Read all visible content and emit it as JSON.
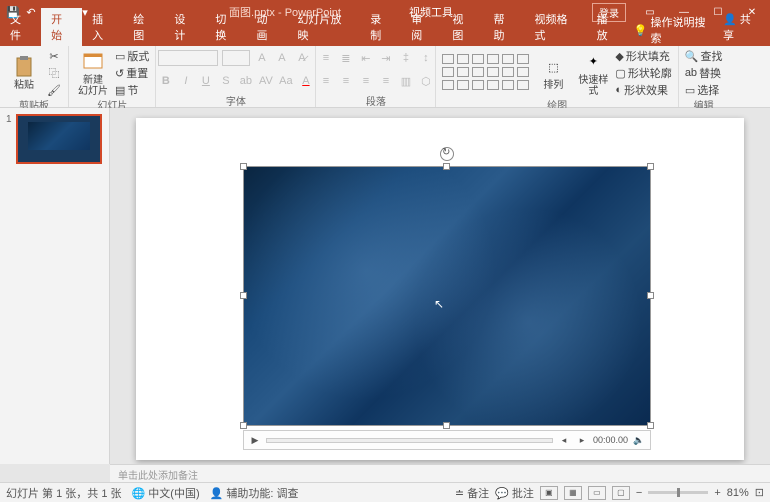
{
  "app": {
    "filename": "面图.pptx",
    "name": "PowerPoint",
    "context_tool": "视频工具"
  },
  "login": "登录",
  "tabs": {
    "items": [
      "文件",
      "开始",
      "插入",
      "绘图",
      "设计",
      "切换",
      "动画",
      "幻灯片放映",
      "录制",
      "审阅",
      "视图",
      "帮助",
      "视频格式",
      "播放"
    ],
    "active": "开始",
    "tellme": "操作说明搜索",
    "share": "共享"
  },
  "ribbon": {
    "clipboard": {
      "paste": "粘贴",
      "label": "剪贴板"
    },
    "slides": {
      "new": "新建\n幻灯片",
      "layout": "版式",
      "reset": "重置",
      "section": "节",
      "label": "幻灯片"
    },
    "font": {
      "label": "字体"
    },
    "para": {
      "label": "段落"
    },
    "drawing": {
      "arrange": "排列",
      "quick": "快速样式",
      "fill": "形状填充",
      "outline": "形状轮廓",
      "effects": "形状效果",
      "label": "绘图"
    },
    "editing": {
      "find": "查找",
      "replace": "替换",
      "select": "选择",
      "label": "编辑"
    }
  },
  "thumb": {
    "num": "1"
  },
  "media": {
    "time": "00:00.00"
  },
  "notes": {
    "placeholder": "单击此处添加备注"
  },
  "status": {
    "slide": "幻灯片 第 1 张，共 1 张",
    "lang": "中文(中国)",
    "a11y": "辅助功能: 调查",
    "notes": "备注",
    "comments": "批注",
    "zoom": "81%"
  }
}
